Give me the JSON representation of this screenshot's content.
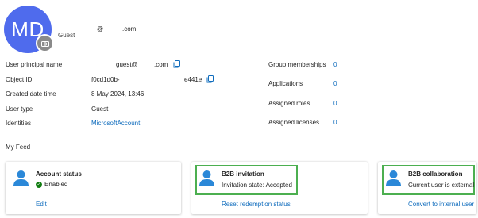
{
  "header": {
    "initials": "MD",
    "user_type": "Guest",
    "email_at": "@",
    "email_domain": ".com"
  },
  "properties": {
    "upn": {
      "label": "User principal name",
      "value_start": "guest@",
      "value_end": ".com"
    },
    "object_id": {
      "label": "Object ID",
      "value_start": "f0cd1d0b-",
      "value_end": "e441e"
    },
    "created": {
      "label": "Created date time",
      "value": "8 May 2024, 13:46"
    },
    "user_type": {
      "label": "User type",
      "value": "Guest"
    },
    "identities": {
      "label": "Identities",
      "value": "MicrosoftAccount"
    }
  },
  "counts": {
    "group_memberships": {
      "label": "Group memberships",
      "value": "0"
    },
    "applications": {
      "label": "Applications",
      "value": "0"
    },
    "assigned_roles": {
      "label": "Assigned roles",
      "value": "0"
    },
    "assigned_licenses": {
      "label": "Assigned licenses",
      "value": "0"
    }
  },
  "feed": {
    "title": "My Feed",
    "cards": [
      {
        "title": "Account status",
        "subtitle": "Enabled",
        "action": "Edit"
      },
      {
        "title": "B2B invitation",
        "subtitle": "Invitation state: Accepted",
        "action": "Reset redemption status"
      },
      {
        "title": "B2B collaboration",
        "subtitle": "Current user is external",
        "action": "Convert to internal user"
      }
    ]
  },
  "colors": {
    "avatar": "#4f6bed",
    "link": "#0f6cbd",
    "highlight": "#4caf50",
    "enabled": "#107c10"
  }
}
